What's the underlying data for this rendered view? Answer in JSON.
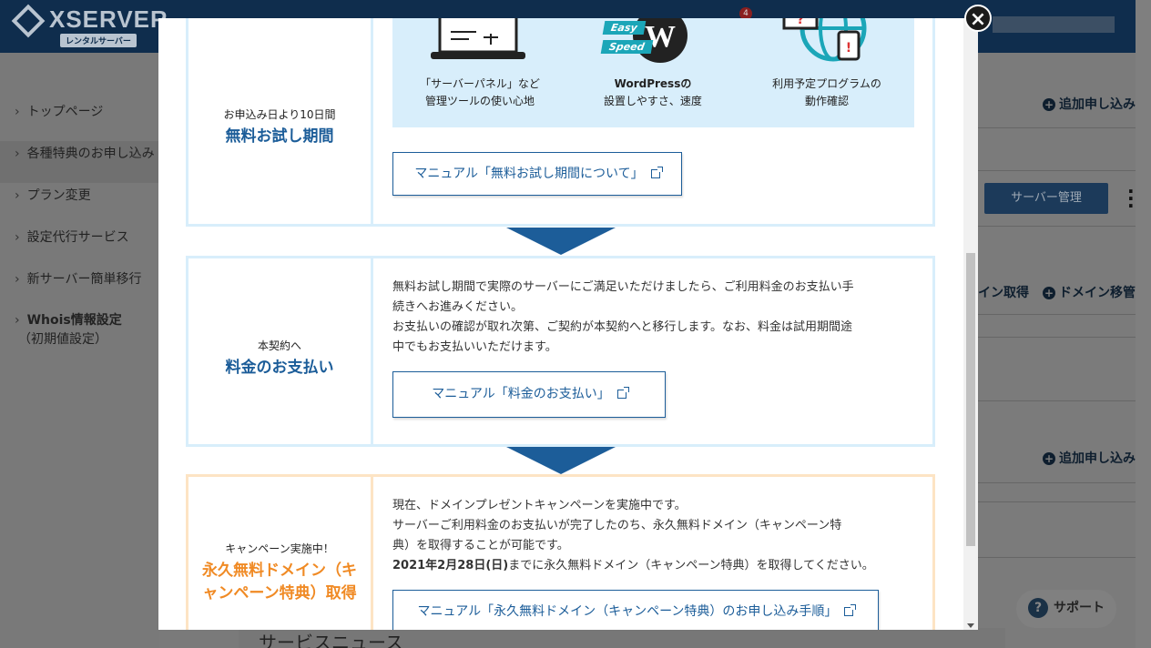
{
  "background": {
    "logo_text": "XSERVER",
    "logo_sub": "レンタルサーバー",
    "notification_count": "4",
    "sidebar": [
      {
        "label": "トップページ"
      },
      {
        "label": "各種特典のお申し込み"
      },
      {
        "label": "プラン変更"
      },
      {
        "label": "設定代行サービス"
      },
      {
        "label": "新サーバー簡単移行"
      },
      {
        "label": "Whois情報設定",
        "sub": "（初期値設定）"
      }
    ],
    "add_apply_1": "追加申し込み",
    "server_manage_button": "サーバー管理",
    "domain_get": "イン取得",
    "domain_transfer": "ドメイン移管",
    "add_apply_2": "追加申し込み",
    "service_news": "サービスニュース",
    "support_button": "サポート"
  },
  "modal": {
    "step1": {
      "sub": "お申込み日より10日間",
      "title": "無料お試し期間",
      "features": [
        {
          "line1": "「サーバーパネル」など",
          "line2": "管理ツールの使い心地"
        },
        {
          "line1": "WordPressの",
          "line2": "設置しやすさ、速度"
        },
        {
          "line1": "利用予定プログラムの",
          "line2": "動作確認"
        }
      ],
      "easy_label": "Easy",
      "speed_label": "Speed",
      "manual_button": "マニュアル「無料お試し期間について」"
    },
    "step2": {
      "sub": "本契約へ",
      "title": "料金のお支払い",
      "para1_line1": "無料お試し期間で実際のサーバーにご満足いただけましたら、ご利用料金のお支払い手",
      "para1_line2": "続きへお進みください。",
      "para2_line1": "お支払いの確認が取れ次第、ご契約が本契約へと移行します。なお、料金は試用期間途",
      "para2_line2": "中でもお支払いいただけます。",
      "manual_button": "マニュアル「料金のお支払い」"
    },
    "step3": {
      "sub": "キャンペーン実施中！",
      "title_line1": "永久無料ドメイン（キ",
      "title_line2": "ャンペーン特典）取得",
      "para1": "現在、ドメインプレゼントキャンペーンを実施中です。",
      "para2_line1": "サーバーご利用料金のお支払いが完了したのち、永久無料ドメイン（キャンペーン特",
      "para2_line2": "典）を取得することが可能です。",
      "para3_bold": "2021年2月28日(日)",
      "para3_rest": "までに永久無料ドメイン（キャンペーン特典）を取得してください。",
      "manual_button": "マニュアル「永久無料ドメイン（キャンペーン特典）のお申し込み手順」"
    },
    "close_symbol": "×"
  }
}
